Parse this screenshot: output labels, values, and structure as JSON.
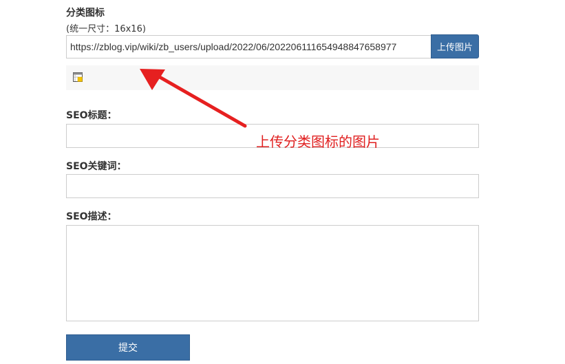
{
  "category_icon": {
    "label": "分类图标",
    "hint": "(统一尺寸：16x16)",
    "url_value": "https://zblog.vip/wiki/zb_users/upload/2022/06/202206111654948847658977",
    "upload_button_label": "上传图片"
  },
  "seo_title": {
    "label": "SEO标题："
  },
  "seo_keywords": {
    "label": "SEO关键词："
  },
  "seo_description": {
    "label": "SEO描述："
  },
  "submit_button_label": "提交",
  "annotation": {
    "text": "上传分类图标的图片",
    "color": "#e02020"
  },
  "colors": {
    "button_bg": "#3a6ea5",
    "input_border": "#cccccc",
    "preview_bg": "#f7f7f7"
  },
  "icons": {
    "preview": "window-image-icon"
  }
}
